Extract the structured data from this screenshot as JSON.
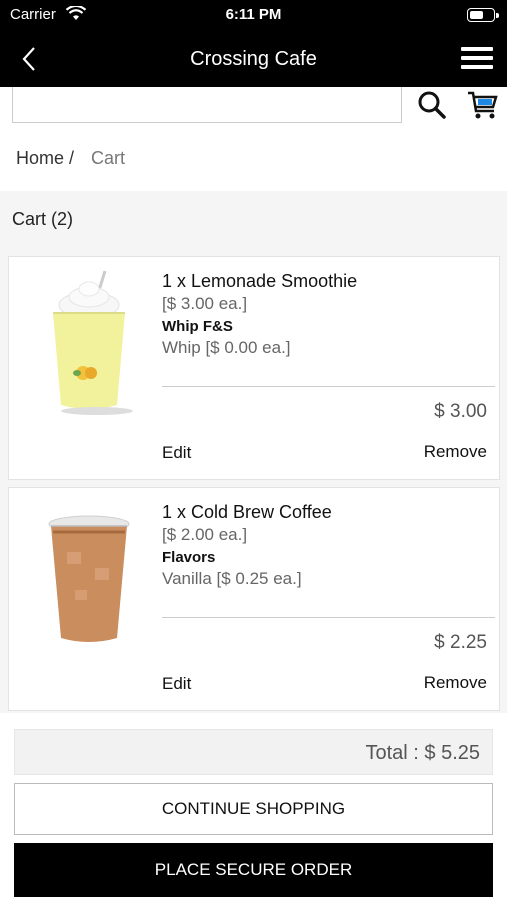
{
  "status_bar": {
    "carrier": "Carrier",
    "time": "6:11 PM",
    "battery_level": 0.6
  },
  "nav": {
    "title": "Crossing Cafe"
  },
  "search": {
    "placeholder": "",
    "value": ""
  },
  "breadcrumb": {
    "home": "Home",
    "separator": "/",
    "current": "Cart"
  },
  "cart": {
    "heading": "Cart (2)",
    "items": [
      {
        "name": "1 x Lemonade Smoothie",
        "unit_price": "[$ 3.00 ea.]",
        "option_group": "Whip F&S",
        "option_value": "Whip [$ 0.00 ea.]",
        "line_total": "$ 3.00",
        "edit_label": "Edit",
        "remove_label": "Remove",
        "image": "lemonade-smoothie-image"
      },
      {
        "name": "1 x Cold Brew Coffee",
        "unit_price": "[$ 2.00 ea.]",
        "option_group": "Flavors",
        "option_value": "Vanilla [$ 0.25 ea.]",
        "line_total": "$ 2.25",
        "edit_label": "Edit",
        "remove_label": "Remove",
        "image": "cold-brew-coffee-image"
      }
    ],
    "total": "Total : $ 5.25",
    "continue_label": "CONTINUE SHOPPING",
    "order_label": "PLACE SECURE ORDER"
  },
  "colors": {
    "bar": "#000000",
    "accent_cart": "#1e88e5",
    "primary_button": "#000000"
  }
}
